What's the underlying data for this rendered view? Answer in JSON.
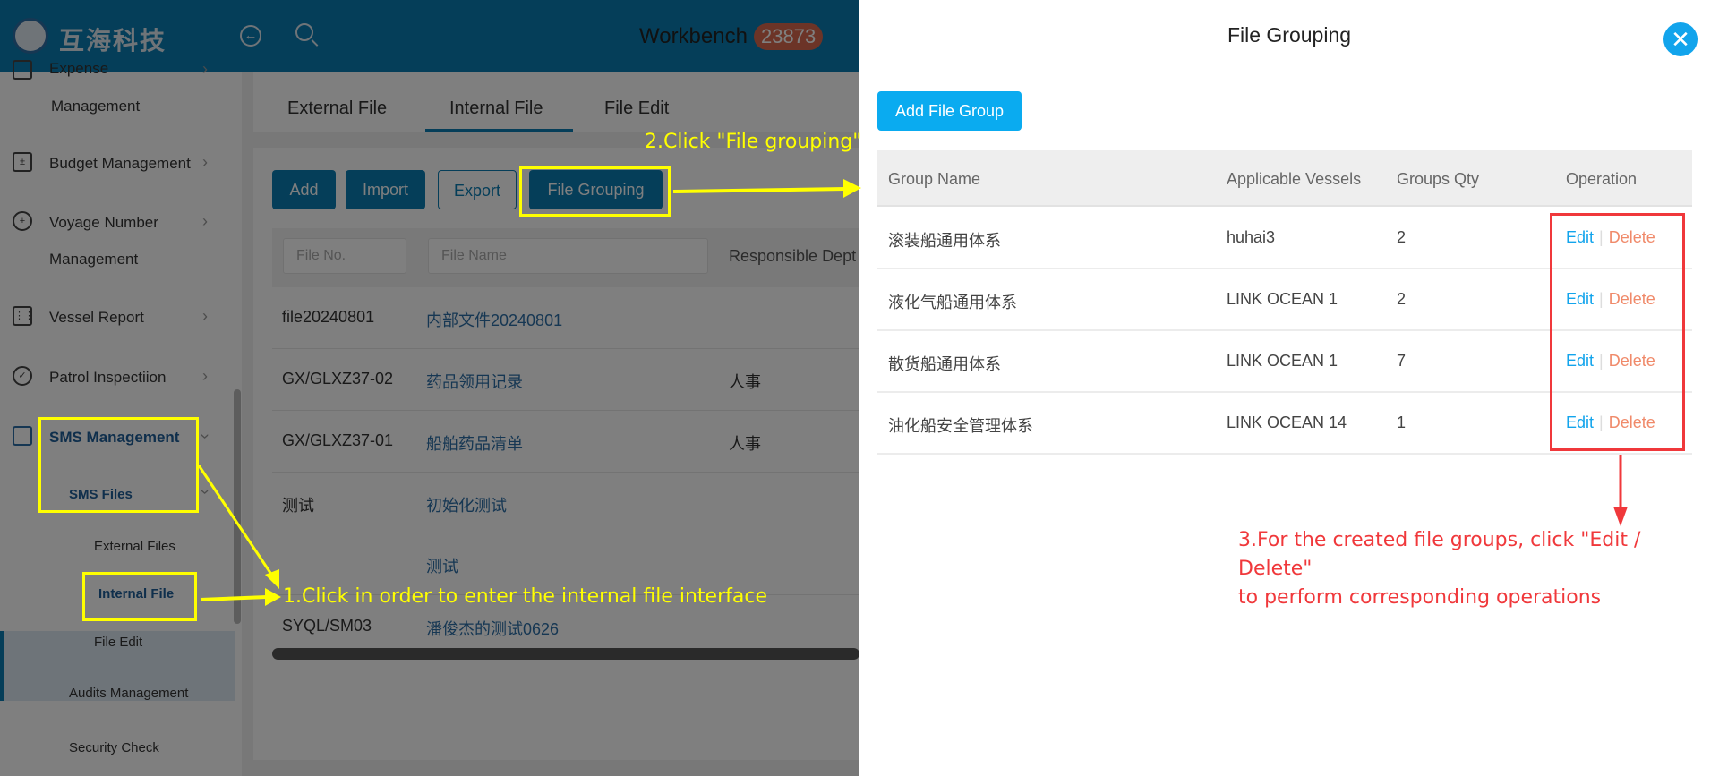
{
  "header": {
    "logo_text": "互海科技",
    "workbench_label": "Workbench",
    "badge_count": "23873"
  },
  "sidebar": {
    "items": [
      {
        "label": "Expense",
        "label2": "Management",
        "icon": "coins-icon"
      },
      {
        "label": "Budget Management",
        "icon": "calculator-icon"
      },
      {
        "label": "Voyage Number",
        "label2": "Management",
        "icon": "globe-icon"
      },
      {
        "label": "Vessel Report",
        "icon": "calendar-icon"
      },
      {
        "label": "Patrol Inspectiion",
        "icon": "check-circle-icon"
      },
      {
        "label": "SMS Management",
        "icon": "documents-icon"
      }
    ],
    "sub": {
      "sms_files": "SMS Files",
      "external_files": "External Files",
      "internal_file": "Internal File",
      "file_edit": "File Edit",
      "audits": "Audits Management",
      "security": "Security Check"
    }
  },
  "main": {
    "tabs": [
      "External File",
      "Internal File",
      "File Edit"
    ],
    "buttons": {
      "add": "Add",
      "import": "Import",
      "export": "Export",
      "file_grouping": "File Grouping"
    },
    "filters": {
      "file_no": "File No.",
      "file_name": "File Name",
      "responsible_dept": "Responsible Dept"
    },
    "rows": [
      [
        "file20240801",
        "内部文件20240801",
        ""
      ],
      [
        "GX/GLXZ37-02",
        "药品领用记录",
        "人事"
      ],
      [
        "GX/GLXZ37-01",
        "船舶药品清单",
        "人事"
      ],
      [
        "测试",
        "初始化测试",
        ""
      ],
      [
        "",
        "测试",
        ""
      ],
      [
        "SYQL/SM03",
        "潘俊杰的测试0626",
        ""
      ]
    ]
  },
  "drawer": {
    "title": "File Grouping",
    "add_button": "Add File Group",
    "columns": [
      "Group Name",
      "Applicable Vessels",
      "Groups Qty",
      "Operation"
    ],
    "rows": [
      {
        "name": "滚装船通用体系",
        "vessels": "huhai3",
        "qty": "2"
      },
      {
        "name": "液化气船通用体系",
        "vessels": "LINK OCEAN 1",
        "qty": "2"
      },
      {
        "name": "散货船通用体系",
        "vessels": "LINK OCEAN 1",
        "qty": "7"
      },
      {
        "name": "油化船安全管理体系",
        "vessels": "LINK OCEAN 14",
        "qty": "1"
      }
    ],
    "edit": "Edit",
    "delete": "Delete"
  },
  "annotations": {
    "step1": "1.Click in order to enter the internal file interface",
    "step2": "2.Click \"File grouping\"",
    "step3_line1": "3.For the created file groups, click \"Edit / Delete\"",
    "step3_line2": "to perform corresponding operations"
  },
  "colors": {
    "primary": "#0a7cb3",
    "drawer_accent": "#12a4ec",
    "delete": "#f08a6a",
    "annotation_yellow": "#ffff00",
    "annotation_red": "#f0383b"
  }
}
